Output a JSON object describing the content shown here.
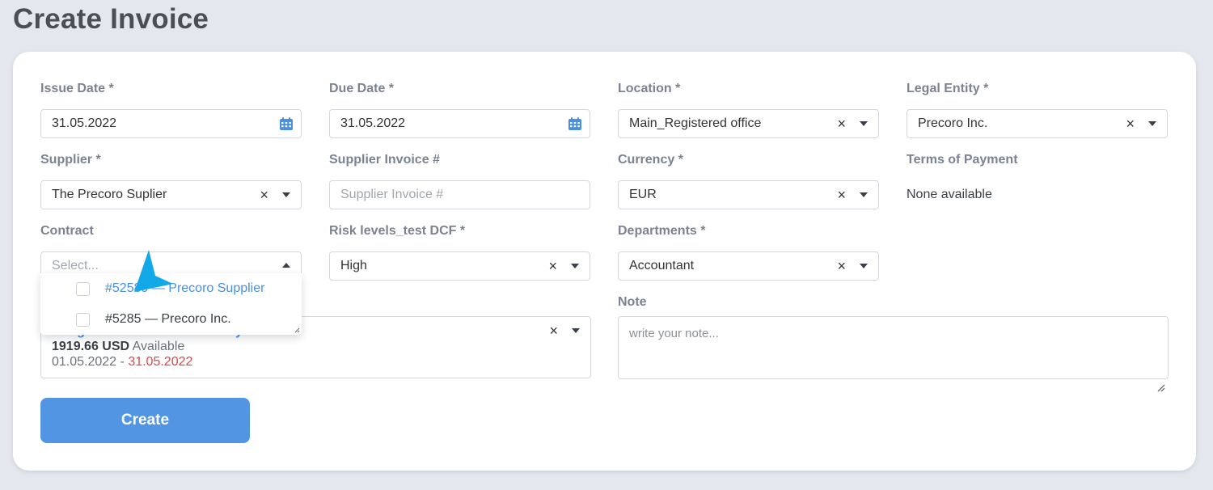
{
  "page": {
    "title": "Create Invoice"
  },
  "fields": {
    "issue_date": {
      "label": "Issue Date *",
      "value": "31.05.2022"
    },
    "due_date": {
      "label": "Due Date *",
      "value": "31.05.2022"
    },
    "location": {
      "label": "Location *",
      "value": "Main_Registered office"
    },
    "legal_entity": {
      "label": "Legal Entity *",
      "value": "Precoro Inc."
    },
    "supplier": {
      "label": "Supplier *",
      "value": "The Precoro Suplier"
    },
    "supplier_invoice": {
      "label": "Supplier Invoice #",
      "placeholder": "Supplier Invoice #"
    },
    "currency": {
      "label": "Currency *",
      "value": "EUR"
    },
    "terms_of_payment": {
      "label": "Terms of Payment",
      "value": "None available"
    },
    "contract": {
      "label": "Contract",
      "placeholder": "Select..."
    },
    "risk_levels": {
      "label": "Risk levels_test DCF *",
      "value": "High"
    },
    "departments": {
      "label": "Departments *",
      "value": "Accountant"
    },
    "note": {
      "label": "Note",
      "placeholder": "write your note..."
    }
  },
  "contract_dropdown": {
    "options": [
      {
        "label": "#52589 — Precoro Supplier"
      },
      {
        "label": "#5285 — Precoro Inc."
      }
    ]
  },
  "budget": {
    "name": "Budget for Accountants in May",
    "amount": "1919.66 USD",
    "available_label": "Available",
    "start_date": "01.05.2022",
    "separator": "-",
    "end_date": "31.05.2022"
  },
  "actions": {
    "create_label": "Create"
  },
  "colors": {
    "accent": "#5296e3",
    "link_blue": "#4a8fe0",
    "danger_red": "#e04848",
    "pointer_blue": "#13a8e8"
  },
  "icons": {
    "calendar": "calendar-icon",
    "clear": "clear-icon",
    "chevron": "chevron-down-icon"
  }
}
